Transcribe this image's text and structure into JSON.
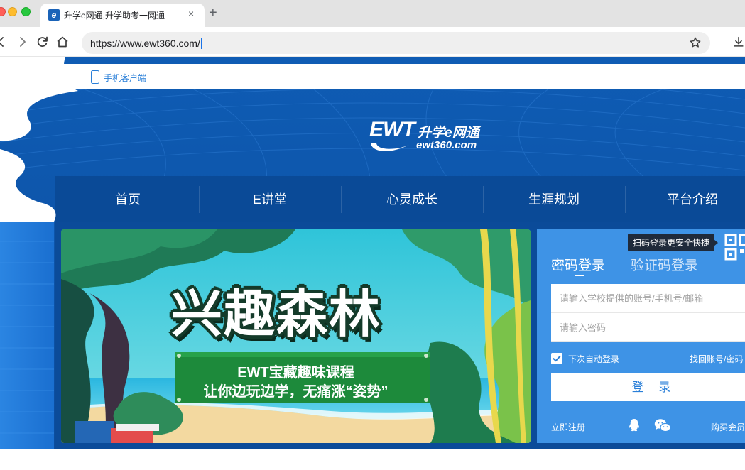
{
  "browser": {
    "tab_title": "升学e网通,升学助考一网通",
    "tab_favicon_letter": "e",
    "tab_close": "×",
    "new_tab": "+",
    "url": "https://www.ewt360.com/"
  },
  "topbar": {
    "mobile_client": "手机客户端"
  },
  "logo": {
    "mark": "EWT",
    "name": "升学e网通",
    "domain": "ewt360.com"
  },
  "nav": {
    "items": [
      {
        "label": "首页"
      },
      {
        "label": "E讲堂"
      },
      {
        "label": "心灵成长"
      },
      {
        "label": "生涯规划"
      },
      {
        "label": "平台介绍"
      }
    ]
  },
  "banner": {
    "title": "兴趣森林",
    "line1": "EWT宝藏趣味课程",
    "line2": "让你边玩边学，无痛涨“姿势”"
  },
  "login": {
    "qr_tip": "扫码登录更安全快捷",
    "tab_password": "密码登录",
    "tab_code": "验证码登录",
    "account_placeholder": "请输入学校提供的账号/手机号/邮箱",
    "password_placeholder": "请输入密码",
    "remember": "下次自动登录",
    "forgot": "找回账号/密码",
    "submit": "登 录",
    "register": "立即注册",
    "buy": "购买会员"
  },
  "colors": {
    "brand_blue": "#0d4f9f",
    "nav_blue": "#0a4a97",
    "panel_blue": "#3e93e6",
    "link_blue": "#2a7fd8"
  }
}
